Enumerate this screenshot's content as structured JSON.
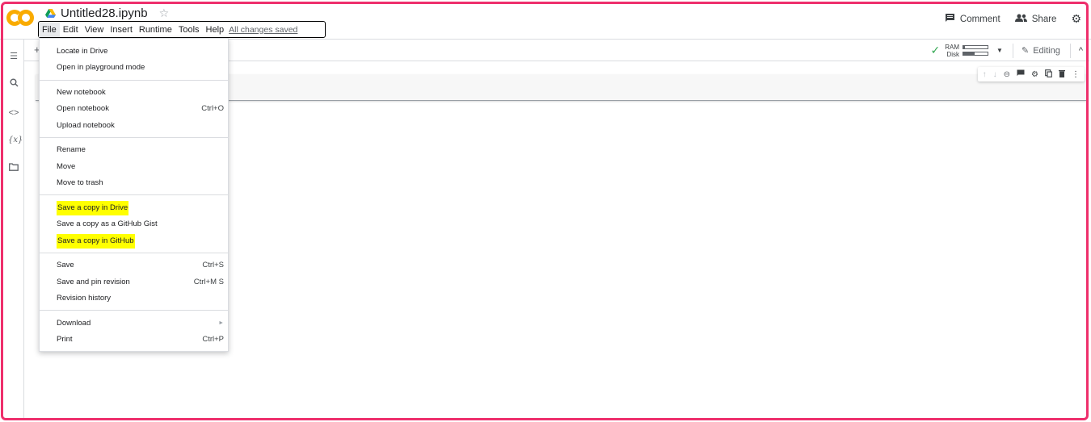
{
  "app": {
    "logo": "CO",
    "notebook_title": "Untitled28.ipynb",
    "icons": {
      "drive": "google-drive-icon",
      "star": "star-icon"
    }
  },
  "menu": {
    "items": [
      "File",
      "Edit",
      "View",
      "Insert",
      "Runtime",
      "Tools",
      "Help"
    ],
    "active": "File",
    "status": "All changes saved"
  },
  "header_right": {
    "comment_label": "Comment",
    "share_label": "Share"
  },
  "toolbar": {
    "plus": "+",
    "ram_label": "RAM",
    "disk_label": "Disk",
    "ram_fill": 0.05,
    "disk_fill": 0.45,
    "editing_label": "Editing"
  },
  "file_menu": {
    "items": [
      {
        "label": "Locate in Drive",
        "shortcut": ""
      },
      {
        "label": "Open in playground mode",
        "shortcut": ""
      },
      {
        "label": "New notebook",
        "shortcut": ""
      },
      {
        "label": "Open notebook",
        "shortcut": "Ctrl+O"
      },
      {
        "label": "Upload notebook",
        "shortcut": ""
      },
      {
        "label": "Rename",
        "shortcut": ""
      },
      {
        "label": "Move",
        "shortcut": ""
      },
      {
        "label": "Move to trash",
        "shortcut": ""
      },
      {
        "label": "Save a copy in Drive",
        "shortcut": "",
        "highlighted": true
      },
      {
        "label": "Save a copy as a GitHub Gist",
        "shortcut": ""
      },
      {
        "label": "Save a copy in GitHub",
        "shortcut": "",
        "highlighted": true
      },
      {
        "label": "Save",
        "shortcut": "Ctrl+S"
      },
      {
        "label": "Save and pin revision",
        "shortcut": "Ctrl+M S"
      },
      {
        "label": "Revision history",
        "shortcut": ""
      },
      {
        "label": "Download",
        "shortcut": "►"
      },
      {
        "label": "Print",
        "shortcut": "Ctrl+P"
      }
    ]
  },
  "colors": {
    "frame": "#ee2f6c",
    "logo": "#f9ab00",
    "highlight": "#ffff00",
    "check": "#34a853"
  }
}
